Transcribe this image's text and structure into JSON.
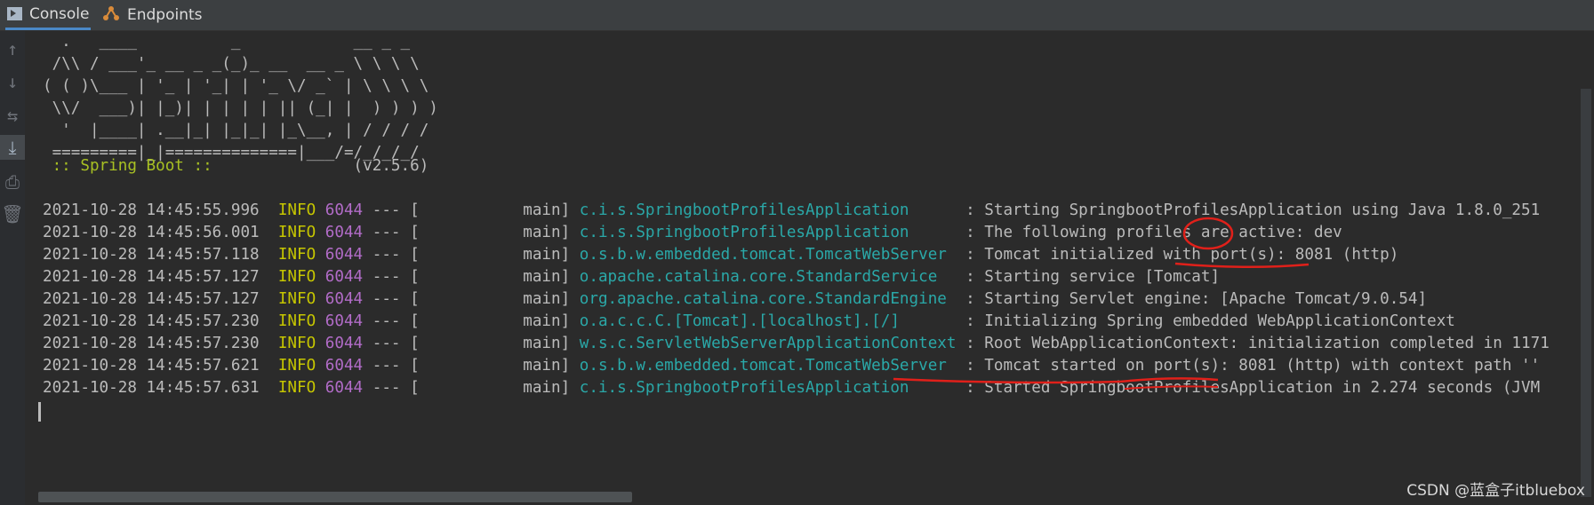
{
  "tabs": [
    {
      "label": "Console",
      "icon": "console-icon",
      "active": true
    },
    {
      "label": "Endpoints",
      "icon": "endpoints-icon",
      "active": false
    }
  ],
  "gutter": [
    {
      "icon": "arrow-up-icon",
      "glyph": "↑"
    },
    {
      "icon": "arrow-down-icon",
      "glyph": "↓"
    },
    {
      "icon": "soft-wrap-icon",
      "glyph": "⇆"
    },
    {
      "icon": "scroll-to-end-icon",
      "glyph": "⤓"
    },
    {
      "icon": "print-icon",
      "glyph": "⎙"
    },
    {
      "icon": "trash-icon",
      "glyph": "🗑"
    }
  ],
  "banner": [
    "  .   ____          _            __ _ _",
    " /\\\\ / ___'_ __ _ _(_)_ __  __ _ \\ \\ \\ \\",
    "( ( )\\___ | '_ | '_| | '_ \\/ _` | \\ \\ \\ \\",
    " \\\\/  ___)| |_)| | | | | || (_| |  ) ) ) )",
    "  '  |____| .__|_| |_|_| |_\\__, | / / / /",
    " =========|_|==============|___/=/_/_/_/"
  ],
  "boot_label": " :: Spring Boot :: ",
  "boot_version": "              (v2.5.6)",
  "logs": [
    {
      "date": "2021-10-28 14:45:55.996",
      "level": "INFO",
      "pid": "6044",
      "thread": " --- [           main] ",
      "logger": "c.i.s.SpringbootProfilesApplication     ",
      "message": " : Starting SpringbootProfilesApplication using Java 1.8.0_251"
    },
    {
      "date": "2021-10-28 14:45:56.001",
      "level": "INFO",
      "pid": "6044",
      "thread": " --- [           main] ",
      "logger": "c.i.s.SpringbootProfilesApplication     ",
      "message": " : The following profiles are active: dev"
    },
    {
      "date": "2021-10-28 14:45:57.118",
      "level": "INFO",
      "pid": "6044",
      "thread": " --- [           main] ",
      "logger": "o.s.b.w.embedded.tomcat.TomcatWebServer ",
      "message": " : Tomcat initialized with port(s): 8081 (http)"
    },
    {
      "date": "2021-10-28 14:45:57.127",
      "level": "INFO",
      "pid": "6044",
      "thread": " --- [           main] ",
      "logger": "o.apache.catalina.core.StandardService  ",
      "message": " : Starting service [Tomcat]"
    },
    {
      "date": "2021-10-28 14:45:57.127",
      "level": "INFO",
      "pid": "6044",
      "thread": " --- [           main] ",
      "logger": "org.apache.catalina.core.StandardEngine ",
      "message": " : Starting Servlet engine: [Apache Tomcat/9.0.54]"
    },
    {
      "date": "2021-10-28 14:45:57.230",
      "level": "INFO",
      "pid": "6044",
      "thread": " --- [           main] ",
      "logger": "o.a.c.c.C.[Tomcat].[localhost].[/]      ",
      "message": " : Initializing Spring embedded WebApplicationContext"
    },
    {
      "date": "2021-10-28 14:45:57.230",
      "level": "INFO",
      "pid": "6044",
      "thread": " --- [           main] ",
      "logger": "w.s.c.ServletWebServerApplicationContext",
      "message": " : Root WebApplicationContext: initialization completed in 1171"
    },
    {
      "date": "2021-10-28 14:45:57.621",
      "level": "INFO",
      "pid": "6044",
      "thread": " --- [           main] ",
      "logger": "o.s.b.w.embedded.tomcat.TomcatWebServer ",
      "message": " : Tomcat started on port(s): 8081 (http) with context path ''"
    },
    {
      "date": "2021-10-28 14:45:57.631",
      "level": "INFO",
      "pid": "6044",
      "thread": " --- [           main] ",
      "logger": "c.i.s.SpringbootProfilesApplication     ",
      "message": " : Started SpringbootProfilesApplication in 2.274 seconds (JVM"
    }
  ],
  "watermark": "CSDN @蓝盒子itbluebox",
  "colors": {
    "accent": "#4a88c7",
    "level": "#c6c600",
    "pid": "#b26cc8",
    "logger": "#2aa8a8",
    "boot": "#a8c023",
    "annotation": "#e0201a"
  }
}
